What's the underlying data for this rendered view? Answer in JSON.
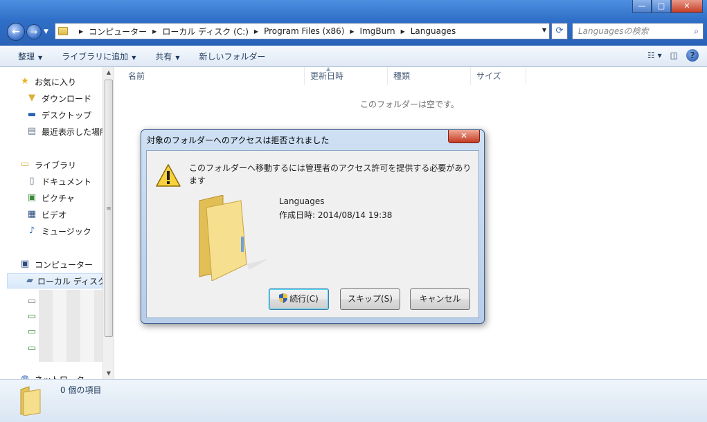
{
  "window": {
    "minimize": "—",
    "maximize": "□",
    "close": "✕"
  },
  "address": {
    "crumbs": [
      "コンピューター",
      "ローカル ディスク (C:)",
      "Program Files (x86)",
      "ImgBurn",
      "Languages"
    ]
  },
  "search": {
    "placeholder": "Languagesの検索"
  },
  "toolbar": {
    "organize": "整理",
    "add_to_library": "ライブラリに追加",
    "share": "共有",
    "new_folder": "新しいフォルダー"
  },
  "nav": {
    "favorites": "お気に入り",
    "downloads": "ダウンロード",
    "desktop": "デスクトップ",
    "recent": "最近表示した場所",
    "libraries": "ライブラリ",
    "documents": "ドキュメント",
    "pictures": "ピクチャ",
    "videos": "ビデオ",
    "music": "ミュージック",
    "computer": "コンピューター",
    "local_disk": "ローカル ディスク",
    "network": "ネットワーク"
  },
  "columns": {
    "name": "名前",
    "date_modified": "更新日時",
    "type": "種類",
    "size": "サイズ"
  },
  "content": {
    "empty_message": "このフォルダーは空です。"
  },
  "status": {
    "item_count": "0 個の項目"
  },
  "dialog": {
    "title": "対象のフォルダーへのアクセスは拒否されました",
    "close": "✕",
    "message": "このフォルダーへ移動するには管理者のアクセス許可を提供する必要があります",
    "folder_name": "Languages",
    "created": "作成日時: 2014/08/14 19:38",
    "continue_label": "続行(C)",
    "skip_label": "スキップ(S)",
    "cancel_label": "キャンセル"
  }
}
